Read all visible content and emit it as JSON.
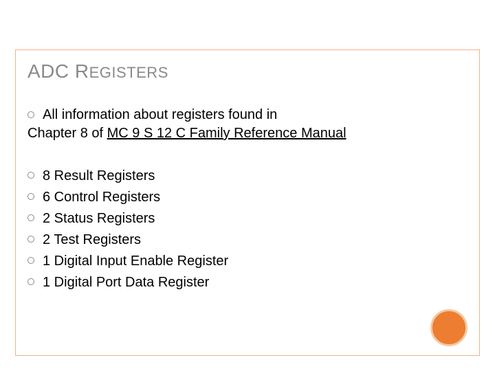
{
  "title": {
    "pre": "ADC R",
    "small": "EGISTERS"
  },
  "intro": {
    "line1": "All information about registers found in",
    "line2_pre": "Chapter 8 of ",
    "line2_link": "MC 9 S 12 C Family Reference Manual"
  },
  "list": [
    "8 Result Registers",
    "6 Control Registers",
    "2 Status Registers",
    "2 Test Registers",
    "1 Digital Input Enable Register",
    "1 Digital Port Data Register"
  ]
}
